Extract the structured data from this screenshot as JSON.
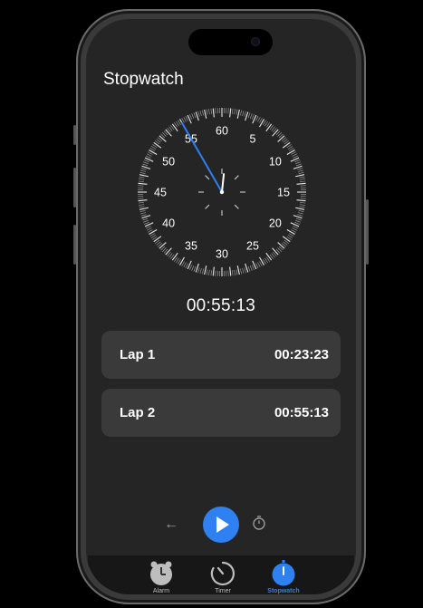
{
  "screen": {
    "title": "Stopwatch"
  },
  "dial": {
    "labels": [
      "60",
      "5",
      "10",
      "15",
      "20",
      "25",
      "30",
      "35",
      "40",
      "45",
      "50",
      "55"
    ],
    "hand_seconds": 55,
    "accent": "#2f80f0"
  },
  "readout": "00:55:13",
  "laps": [
    {
      "label": "Lap 1",
      "time": "00:23:23"
    },
    {
      "label": "Lap 2",
      "time": "00:55:13"
    }
  ],
  "controls": {
    "back_icon": "arrow-left-icon",
    "play_icon": "play-icon",
    "timer_icon": "stopwatch-outline-icon",
    "play_color": "#2f80f0"
  },
  "tabs": [
    {
      "label": "Alarm",
      "icon": "alarm-clock-icon",
      "active": false
    },
    {
      "label": "Timer",
      "icon": "timer-icon",
      "active": false
    },
    {
      "label": "Stopwatch",
      "icon": "stopwatch-icon",
      "active": true
    }
  ]
}
